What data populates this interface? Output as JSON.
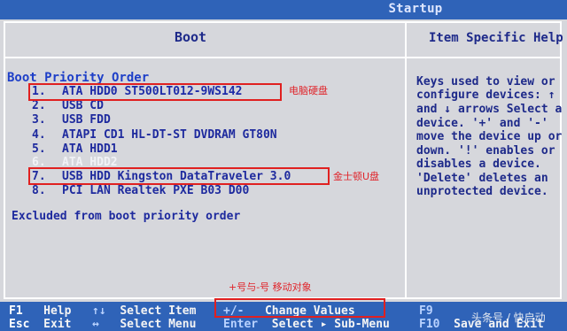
{
  "header": {
    "tab_label": "Startup"
  },
  "panels": {
    "left_title": "Boot",
    "right_title": "Item Specific Help"
  },
  "boot": {
    "section_title": "Boot Priority Order",
    "items": [
      {
        "num": "1.",
        "label": "ATA HDD0 ST500LT012-9WS142"
      },
      {
        "num": "2.",
        "label": "USB CD"
      },
      {
        "num": "3.",
        "label": "USB FDD"
      },
      {
        "num": "4.",
        "label": "ATAPI CD1 HL-DT-ST DVDRAM GT80N"
      },
      {
        "num": "5.",
        "label": "ATA HDD1"
      },
      {
        "num": "6.",
        "label": "ATA HDD2"
      },
      {
        "num": "7.",
        "label": "USB HDD Kingston DataTraveler 3.0"
      },
      {
        "num": "8.",
        "label": "PCI LAN Realtek PXE B03 D00"
      }
    ],
    "excluded_label": "Excluded from boot priority order"
  },
  "annotations": {
    "hdd": "电脑硬盘",
    "usb": "金士顿U盘",
    "keys": "+号与-号 移动对象"
  },
  "help": {
    "lines": [
      "Keys used to view or",
      "configure devices: ↑",
      "and ↓ arrows Select a",
      "device. '+' and '-'",
      "move the device up or",
      "down. '!' enables or",
      "disables a device.",
      "'Delete' deletes an",
      "unprotected device."
    ]
  },
  "footer": {
    "f1_key": "F1",
    "f1_label": "Help",
    "esc_key": "Esc",
    "esc_label": "Exit",
    "updown_key": "↑↓",
    "updown_label": "Select Item",
    "leftright_key": "↔",
    "leftright_label": "Select Menu",
    "plusminus_key": "+/-",
    "plusminus_label": "Change Values",
    "enter_key": "Enter",
    "enter_label": "Select ▸ Sub-Menu",
    "f9_key": "F9",
    "f10_key": "F10",
    "f10_label": "Save and Exit"
  },
  "watermark": "头条号 / 快启动"
}
